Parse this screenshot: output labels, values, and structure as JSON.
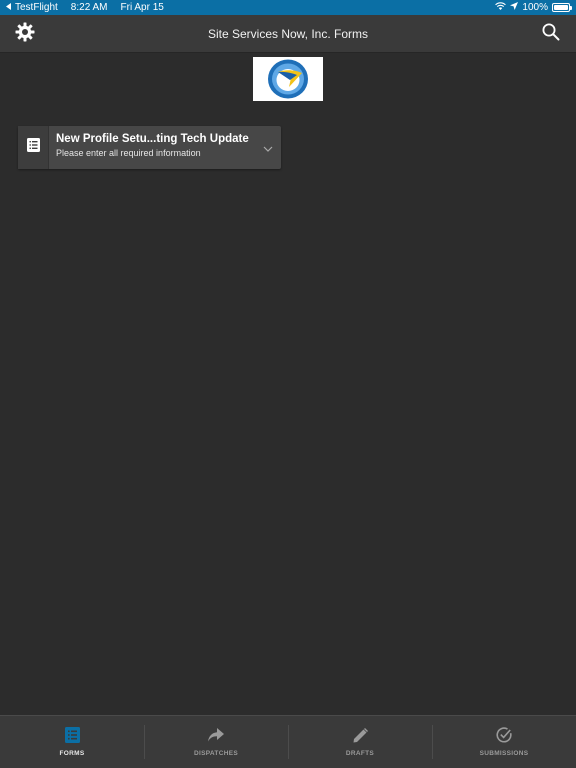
{
  "status_bar": {
    "back_app": "TestFlight",
    "time": "8:22 AM",
    "date": "Fri Apr 15",
    "battery_percent": "100%",
    "battery_level": 1.0
  },
  "nav_bar": {
    "title": "Site Services Now, Inc. Forms",
    "left_icon": "gear-icon",
    "right_icon": "search-icon"
  },
  "form_card": {
    "title": "New Profile Setu...ting Tech Update",
    "subtitle": "Please enter all required information",
    "icon": "form-list-icon"
  },
  "tabs": [
    {
      "label": "FORMS",
      "icon": "forms-icon",
      "active": true
    },
    {
      "label": "DISPATCHES",
      "icon": "share-arrow-icon",
      "active": false
    },
    {
      "label": "DRAFTS",
      "icon": "pencil-icon",
      "active": false
    },
    {
      "label": "SUBMISSIONS",
      "icon": "check-circle-icon",
      "active": false
    }
  ],
  "colors": {
    "status_bar_bg": "#0b6fa5",
    "nav_bg": "#3a3a3a",
    "body_bg": "#2c2c2c",
    "card_bg": "#474747",
    "active_tab_icon": "#0b6fa5"
  }
}
